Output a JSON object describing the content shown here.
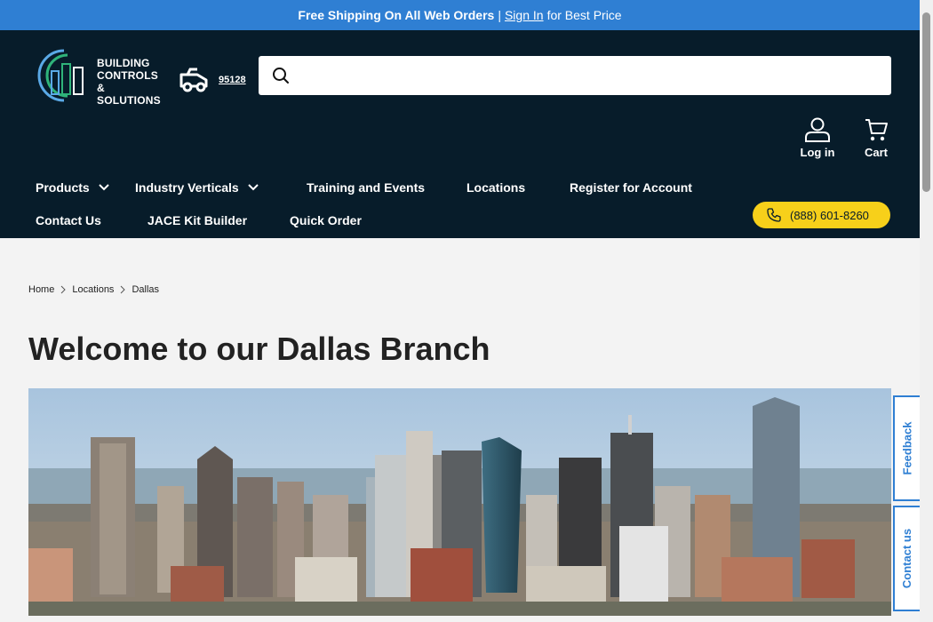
{
  "promo": {
    "bold_text": "Free Shipping On All Web Orders",
    "separator": "|",
    "signin_link": "Sign In",
    "trailing_text": "for Best Price"
  },
  "logo": {
    "line1": "BUILDING",
    "line2": "CONTROLS",
    "line3": "& SOLUTIONS"
  },
  "delivery": {
    "zip": "95128",
    "icon": "delivery-truck-icon"
  },
  "search": {
    "value": "",
    "placeholder": "",
    "icon": "search-icon"
  },
  "account": {
    "login_label": "Log in",
    "cart_label": "Cart"
  },
  "nav": {
    "row1": [
      {
        "label": "Products",
        "has_dropdown": true
      },
      {
        "label": "Industry Verticals",
        "has_dropdown": true
      },
      {
        "label": "Training and Events",
        "has_dropdown": false
      },
      {
        "label": "Locations",
        "has_dropdown": false
      },
      {
        "label": "Register for Account",
        "has_dropdown": false
      }
    ],
    "row2": [
      {
        "label": "Contact Us"
      },
      {
        "label": "JACE Kit Builder"
      },
      {
        "label": "Quick Order"
      }
    ],
    "phone": "(888) 601-8260"
  },
  "breadcrumb": [
    "Home",
    "Locations",
    "Dallas"
  ],
  "page": {
    "title": "Welcome to our Dallas Branch"
  },
  "side_tabs": {
    "feedback": "Feedback",
    "contact": "Contact us"
  },
  "colors": {
    "promo_bar": "#2f7fd3",
    "header_bg": "#071c2a",
    "phone_button": "#f7d01a",
    "page_bg": "#f3f3f3"
  }
}
